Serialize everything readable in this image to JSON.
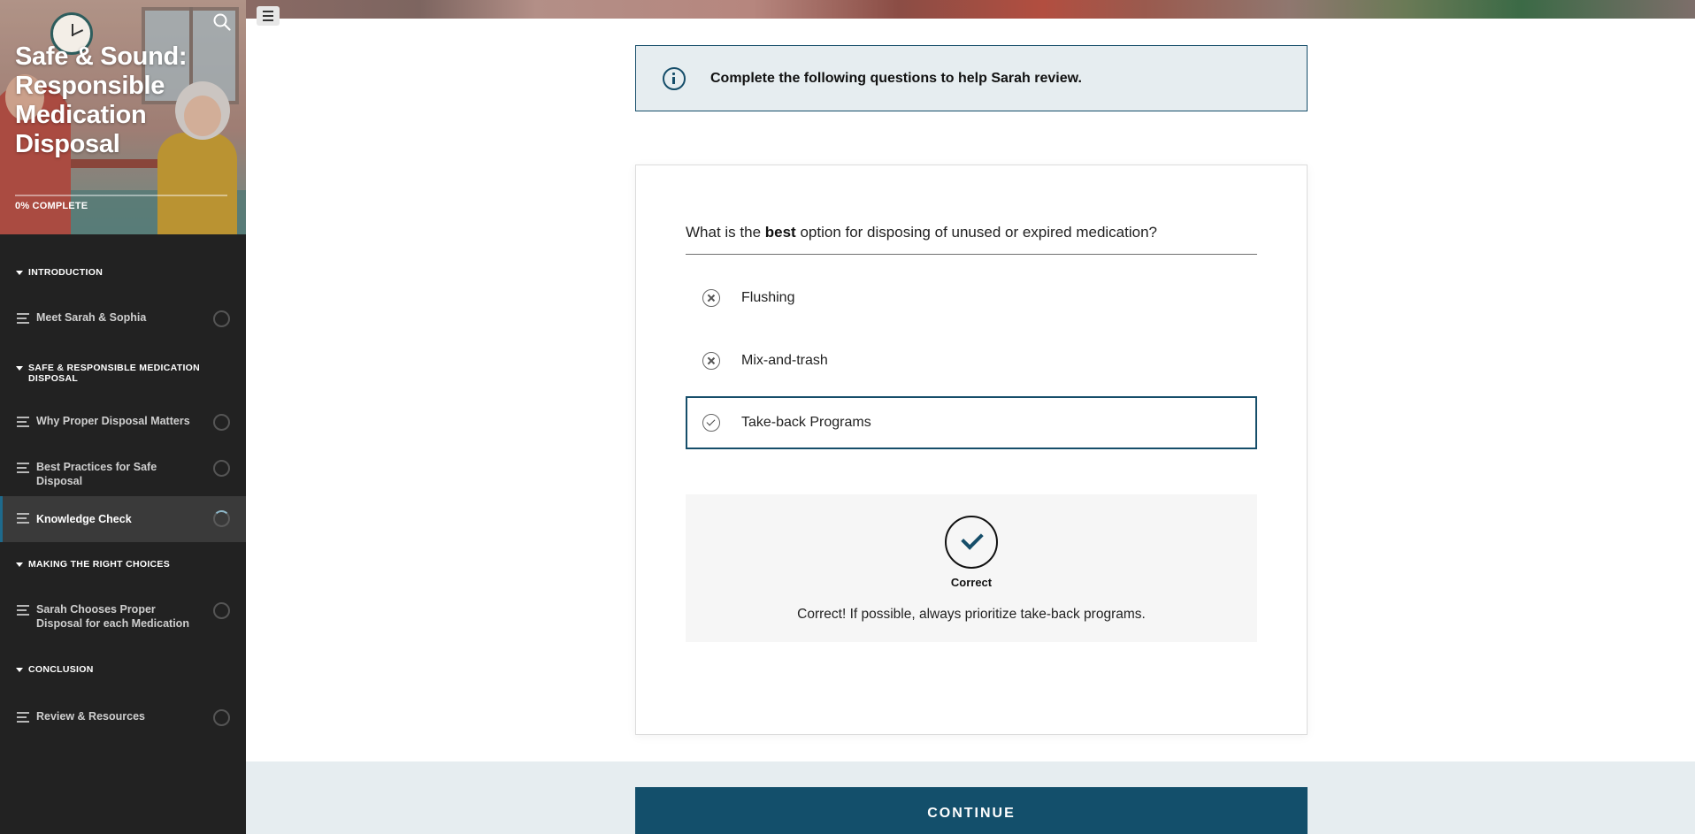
{
  "sidebar": {
    "course_title": "Safe & Sound: Responsible Medication Disposal",
    "progress_percent": 0,
    "progress_label": "0% COMPLETE",
    "sections": [
      {
        "title": "INTRODUCTION",
        "lessons": [
          {
            "label": "Meet Sarah & Sophia",
            "status": "not-started"
          }
        ]
      },
      {
        "title": "SAFE & RESPONSIBLE MEDICATION DISPOSAL",
        "lessons": [
          {
            "label": "Why Proper Disposal Matters",
            "status": "not-started"
          },
          {
            "label": "Best Practices for Safe Disposal",
            "status": "not-started"
          },
          {
            "label": "Knowledge Check",
            "status": "in-progress",
            "active": true
          }
        ]
      },
      {
        "title": "MAKING THE RIGHT CHOICES",
        "lessons": [
          {
            "label": "Sarah Chooses Proper Disposal for each Medication",
            "status": "not-started"
          }
        ]
      },
      {
        "title": "CONCLUSION",
        "lessons": [
          {
            "label": "Review & Resources",
            "status": "not-started"
          }
        ]
      }
    ]
  },
  "main": {
    "instruction": "Complete the following questions to help Sarah review.",
    "question": {
      "before": "What is the ",
      "emphasis": "best",
      "after": " option for disposing of unused or expired medication?"
    },
    "options": [
      {
        "label": "Flushing",
        "state": "incorrect"
      },
      {
        "label": "Mix-and-trash",
        "state": "incorrect"
      },
      {
        "label": "Take-back Programs",
        "state": "correct",
        "selected": true
      }
    ],
    "feedback": {
      "title": "Correct",
      "text": "Correct! If possible, always prioritize take-back programs."
    },
    "continue_label": "CONTINUE"
  },
  "colors": {
    "accent": "#134f6b",
    "sidebar_bg": "#222222",
    "info_bg": "#e6edf0"
  },
  "icons": [
    "clock-illustration",
    "search-icon",
    "hamburger-menu-icon",
    "info-icon",
    "lines-icon",
    "status-ring-icon",
    "x-circle-icon",
    "check-circle-icon",
    "checkmark-icon"
  ]
}
